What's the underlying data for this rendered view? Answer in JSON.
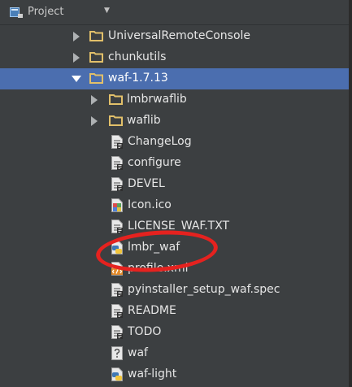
{
  "toolbar": {
    "title": "Project"
  },
  "tree": {
    "rows": [
      {
        "label": "UniversalRemoteConsole",
        "type": "folder"
      },
      {
        "label": "chunkutils",
        "type": "folder"
      },
      {
        "label": "waf-1.7.13",
        "type": "folder",
        "expanded": true,
        "selected": true
      },
      {
        "label": "lmbrwaflib",
        "type": "folder"
      },
      {
        "label": "waflib",
        "type": "folder"
      },
      {
        "label": "ChangeLog",
        "type": "text-file"
      },
      {
        "label": "configure",
        "type": "text-file"
      },
      {
        "label": "DEVEL",
        "type": "text-file"
      },
      {
        "label": "Icon.ico",
        "type": "image-file"
      },
      {
        "label": "LICENSE_WAF.TXT",
        "type": "text-file"
      },
      {
        "label": "lmbr_waf",
        "type": "python-file",
        "highlighted": true
      },
      {
        "label": "profile.xml",
        "type": "xml-file"
      },
      {
        "label": "pyinstaller_setup_waf.spec",
        "type": "text-file"
      },
      {
        "label": "README",
        "type": "text-file"
      },
      {
        "label": "TODO",
        "type": "text-file"
      },
      {
        "label": "waf",
        "type": "unknown-file"
      },
      {
        "label": "waf-light",
        "type": "python-file"
      }
    ]
  },
  "colors": {
    "background": "#3c3f41",
    "selection": "#4b6eaf",
    "annotation_circle": "#e5221f"
  }
}
